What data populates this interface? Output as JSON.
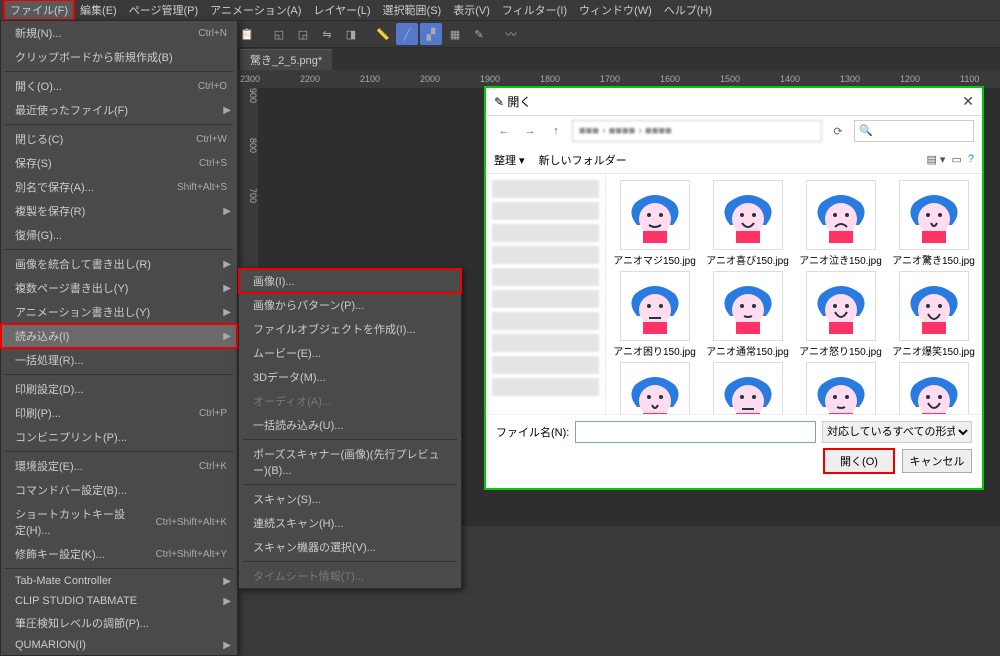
{
  "menubar": {
    "items": [
      "ファイル(F)",
      "編集(E)",
      "ページ管理(P)",
      "アニメーション(A)",
      "レイヤー(L)",
      "選択範囲(S)",
      "表示(V)",
      "フィルター(I)",
      "ウィンドウ(W)",
      "ヘルプ(H)"
    ]
  },
  "tab": {
    "name": "驚き_2_5.png*"
  },
  "ruler_h": [
    "2300",
    "2200",
    "2100",
    "2000",
    "1900",
    "1800",
    "1700",
    "1600",
    "1500",
    "1400",
    "1300",
    "1200",
    "1100"
  ],
  "ruler_v": [
    "900",
    "800",
    "700"
  ],
  "menu_main": [
    {
      "label": "新規(N)...",
      "sc": "Ctrl+N"
    },
    {
      "label": "クリップボードから新規作成(B)"
    },
    {
      "sep": true
    },
    {
      "label": "開く(O)...",
      "sc": "Ctrl+O"
    },
    {
      "label": "最近使ったファイル(F)",
      "arr": true
    },
    {
      "sep": true
    },
    {
      "label": "閉じる(C)",
      "sc": "Ctrl+W"
    },
    {
      "label": "保存(S)",
      "sc": "Ctrl+S"
    },
    {
      "label": "別名で保存(A)...",
      "sc": "Shift+Alt+S"
    },
    {
      "label": "複製を保存(R)",
      "arr": true
    },
    {
      "label": "復帰(G)..."
    },
    {
      "sep": true
    },
    {
      "label": "画像を統合して書き出し(R)",
      "arr": true
    },
    {
      "label": "複数ページ書き出し(Y)",
      "arr": true
    },
    {
      "label": "アニメーション書き出し(Y)",
      "arr": true
    },
    {
      "label": "読み込み(I)",
      "arr": true,
      "hl": true,
      "boxed": true
    },
    {
      "label": "一括処理(R)..."
    },
    {
      "sep": true
    },
    {
      "label": "印刷設定(D)..."
    },
    {
      "label": "印刷(P)...",
      "sc": "Ctrl+P"
    },
    {
      "label": "コンビニプリント(P)..."
    },
    {
      "sep": true
    },
    {
      "label": "環境設定(E)...",
      "sc": "Ctrl+K"
    },
    {
      "label": "コマンドバー設定(B)..."
    },
    {
      "label": "ショートカットキー設定(H)...",
      "sc": "Ctrl+Shift+Alt+K"
    },
    {
      "label": "修飾キー設定(K)...",
      "sc": "Ctrl+Shift+Alt+Y"
    },
    {
      "sep": true
    },
    {
      "label": "Tab-Mate Controller",
      "arr": true
    },
    {
      "label": "CLIP STUDIO TABMATE",
      "arr": true
    },
    {
      "label": "筆圧検知レベルの調節(P)..."
    },
    {
      "label": "QUMARION(I)",
      "arr": true
    }
  ],
  "menu_sub": [
    {
      "label": "画像(I)...",
      "boxed": true
    },
    {
      "label": "画像からパターン(P)..."
    },
    {
      "label": "ファイルオブジェクトを作成(I)..."
    },
    {
      "label": "ムービー(E)..."
    },
    {
      "label": "3Dデータ(M)..."
    },
    {
      "label": "オーディオ(A)...",
      "dis": true
    },
    {
      "label": "一括読み込み(U)..."
    },
    {
      "sep": true
    },
    {
      "label": "ポーズスキャナー(画像)(先行プレビュー)(B)..."
    },
    {
      "sep": true
    },
    {
      "label": "スキャン(S)..."
    },
    {
      "label": "連続スキャン(H)..."
    },
    {
      "label": "スキャン機器の選択(V)..."
    },
    {
      "sep": true
    },
    {
      "label": "タイムシート情報(T)...",
      "dis": true
    }
  ],
  "dialog": {
    "title": "開く",
    "organize": "整理 ▾",
    "new_folder": "新しいフォルダー",
    "files": [
      "アニオマジ150.jpg",
      "アニオ喜び150.jpg",
      "アニオ泣き150.jpg",
      "アニオ驚き150.jpg",
      "アニオ困り150.jpg",
      "アニオ通常150.jpg",
      "アニオ怒り150.jpg",
      "アニオ爆笑150.jpg"
    ],
    "filename_label": "ファイル名(N):",
    "filter": "対応しているすべての形式",
    "open": "開く(O)",
    "cancel": "キャンセル"
  }
}
